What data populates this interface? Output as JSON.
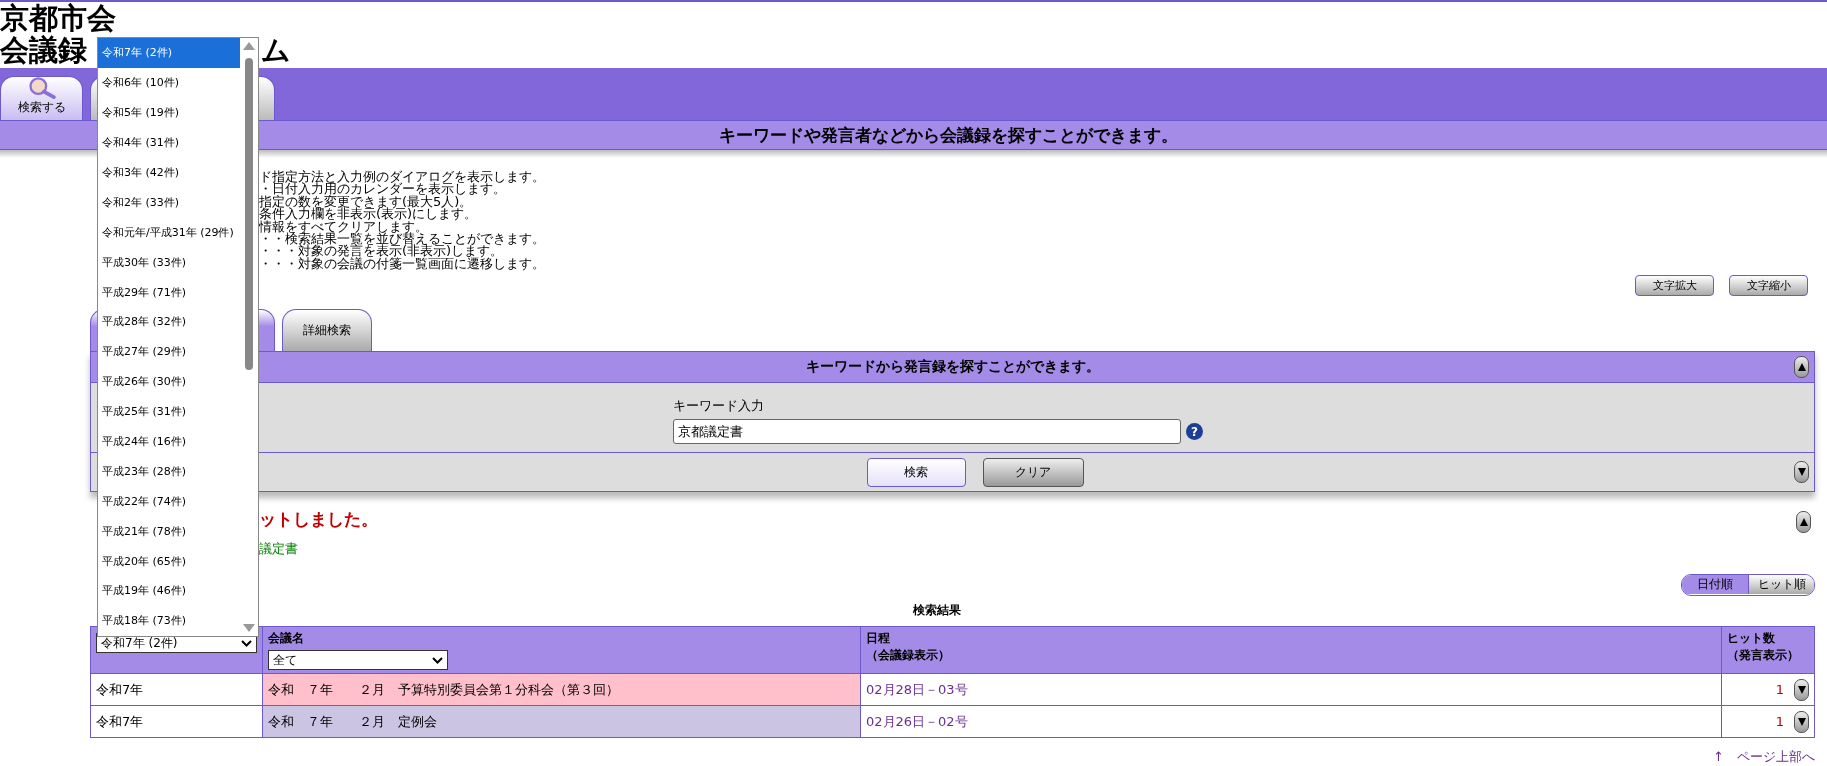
{
  "header": {
    "title_line1": "京都市会",
    "title_line2": [
      "会議録",
      "ム"
    ]
  },
  "main_tabs": [
    {
      "label": "検索する",
      "selected": true
    },
    {
      "selected": false
    }
  ],
  "banner": "キーワードや発言者などから会議録を探すことができます。",
  "help_lines": [
    "ド指定方法と入力例のダイアログを表示します。",
    "・日付入力用のカレンダーを表示します。",
    "指定の数を変更できます(最大5人)。",
    "条件入力欄を非表示(表示)にします。",
    "情報をすべてクリアします。",
    "・・検索結果一覧を並び替えることができます。",
    "・・・対象の発言を表示(非表示)します。",
    "・・・対象の会議の付箋一覧画面に遷移します。"
  ],
  "font_buttons": [
    "文字拡大",
    "文字縮小"
  ],
  "search_tabs": [
    {
      "selected": true
    },
    {
      "label": "詳細検索",
      "selected": false
    }
  ],
  "panel": {
    "title": "キーワードから発言録を探すことができます。",
    "keyword_label": "キーワード入力",
    "keyword_value": "京都議定書",
    "help_icon": "?",
    "buttons": [
      "検索",
      "クリア"
    ]
  },
  "result": {
    "message": "ットしました。",
    "keyword": "議定書"
  },
  "sort": [
    {
      "label": "日付順",
      "selected": true
    },
    {
      "label": "ヒット順",
      "selected": false
    }
  ],
  "table": {
    "caption": "検索結果",
    "columns": [
      {
        "filter": "令和7年 (2件)"
      },
      {
        "label": "会議名",
        "filter": "全て"
      },
      {
        "label": "日程",
        "sub": "（会議録表示）"
      },
      {
        "label": "ヒット数",
        "sub": "（発言表示）"
      }
    ],
    "rows": [
      {
        "year": "令和7年",
        "meeting": "令和　７年　　２月　予算特別委員会第１分科会（第３回）",
        "color": "#ffc0cb",
        "schedule": "02月28日－03号",
        "hits": "1"
      },
      {
        "year": "令和7年",
        "meeting": "令和　７年　　２月　定例会",
        "color": "#cbc5e3",
        "schedule": "02月26日－02号",
        "hits": "1"
      }
    ]
  },
  "dropdown": {
    "options": [
      {
        "label": "令和7年 (2件)",
        "selected": true
      },
      {
        "label": "令和6年 (10件)",
        "selected": false
      },
      {
        "label": "令和5年 (19件)",
        "selected": false
      },
      {
        "label": "令和4年 (31件)",
        "selected": false
      },
      {
        "label": "令和3年 (42件)",
        "selected": false
      },
      {
        "label": "令和2年 (33件)",
        "selected": false
      },
      {
        "label": "令和元年/平成31年 (29件)",
        "selected": false
      },
      {
        "label": "平成30年 (33件)",
        "selected": false
      },
      {
        "label": "平成29年 (71件)",
        "selected": false
      },
      {
        "label": "平成28年 (32件)",
        "selected": false
      },
      {
        "label": "平成27年 (29件)",
        "selected": false
      },
      {
        "label": "平成26年 (30件)",
        "selected": false
      },
      {
        "label": "平成25年 (31件)",
        "selected": false
      },
      {
        "label": "平成24年 (16件)",
        "selected": false
      },
      {
        "label": "平成23年 (28件)",
        "selected": false
      },
      {
        "label": "平成22年 (74件)",
        "selected": false
      },
      {
        "label": "平成21年 (78件)",
        "selected": false
      },
      {
        "label": "平成20年 (65件)",
        "selected": false
      },
      {
        "label": "平成19年 (46件)",
        "selected": false
      },
      {
        "label": "平成18年 (73件)",
        "selected": false
      }
    ]
  },
  "page_top_link": "↑　ページ上部へ"
}
